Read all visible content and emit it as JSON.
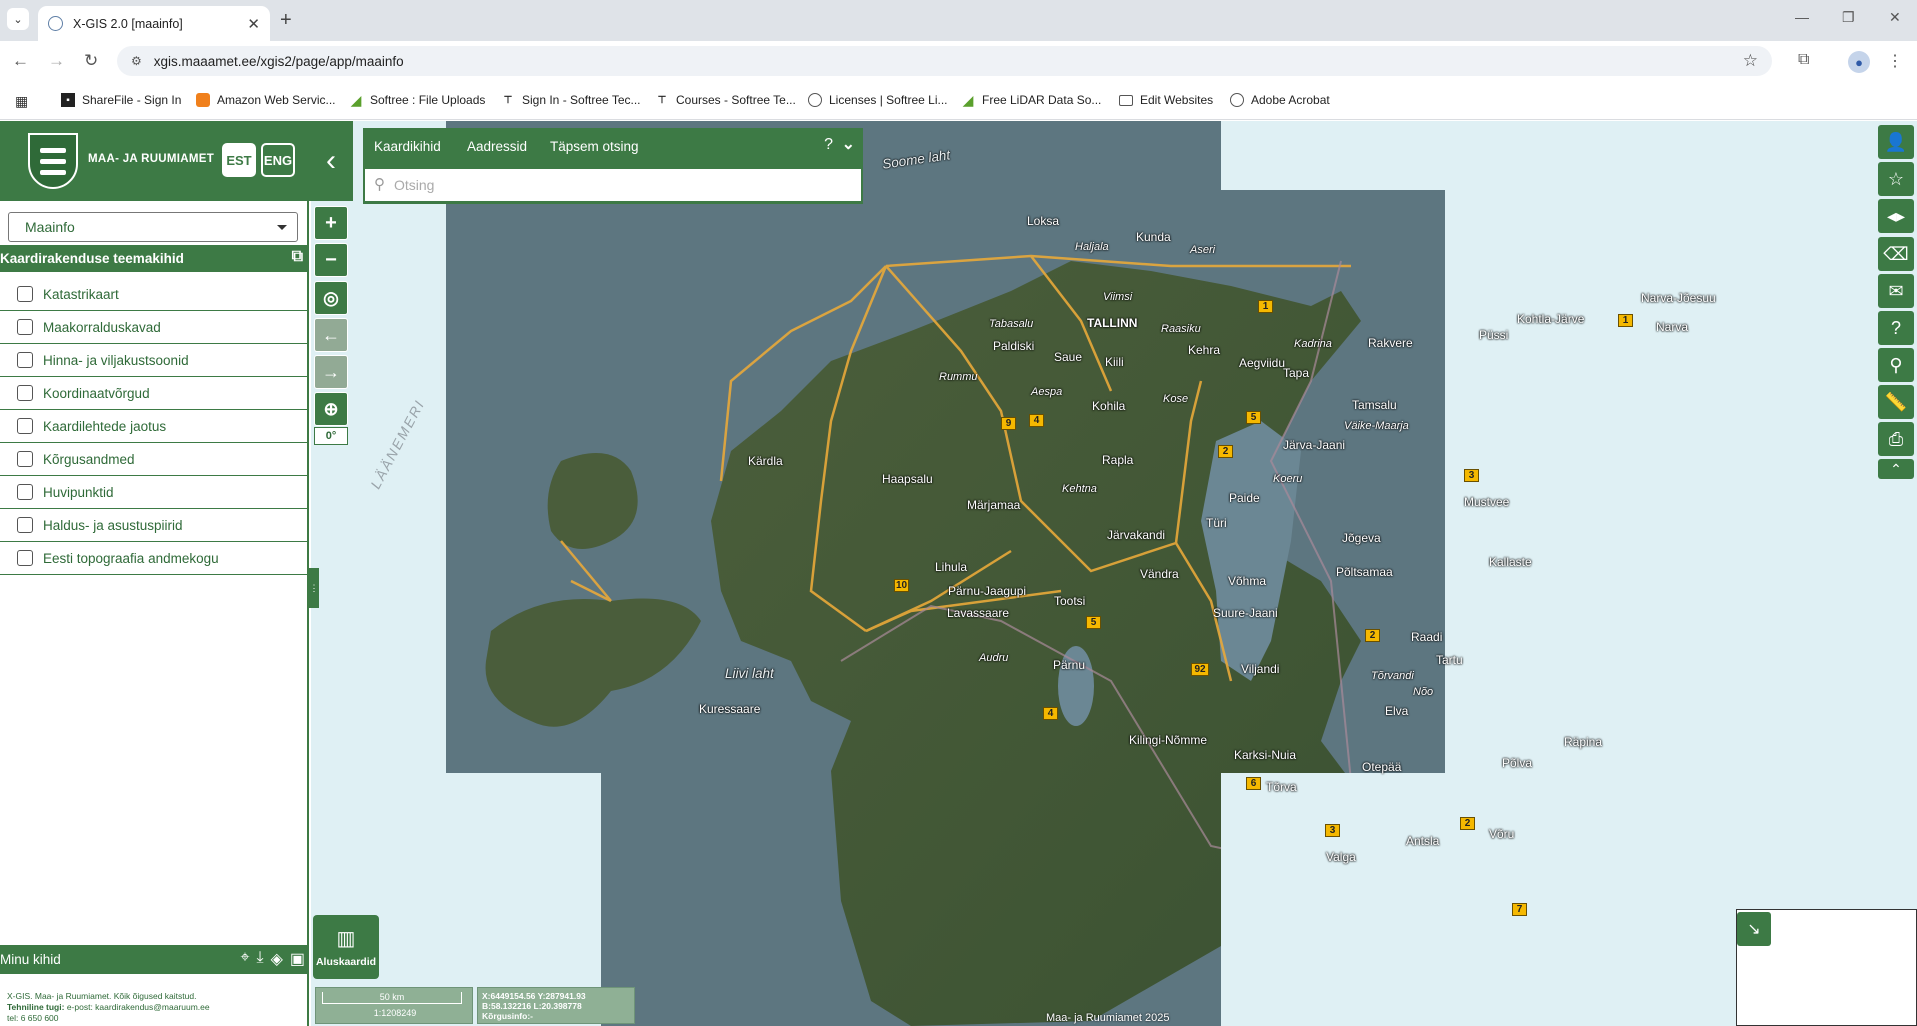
{
  "browser": {
    "tab_title": "X-GIS 2.0 [maainfo]",
    "url": "xgis.maaamet.ee/xgis2/page/app/maainfo",
    "bookmarks": [
      {
        "label": "ShareFile - Sign In",
        "icon": "sharefile-icon"
      },
      {
        "label": "Amazon Web Servic...",
        "icon": "aws-icon"
      },
      {
        "label": "Softree : File Uploads",
        "icon": "softree-icon"
      },
      {
        "label": "Sign In - Softree Tec...",
        "icon": "softree-tec-icon"
      },
      {
        "label": "Courses - Softree Te...",
        "icon": "softree-tec-icon"
      },
      {
        "label": "Licenses | Softree Li...",
        "icon": "globe-icon"
      },
      {
        "label": "Free LiDAR Data So...",
        "icon": "softree-icon"
      },
      {
        "label": "Edit Websites",
        "icon": "folder-icon"
      },
      {
        "label": "Adobe Acrobat",
        "icon": "globe-icon"
      }
    ]
  },
  "header": {
    "brand": "MAA- JA RUUMIAMET",
    "lang_est": "EST",
    "lang_eng": "ENG"
  },
  "sidebar": {
    "app_select": "Maainfo",
    "themes_title": "Kaardirakenduse teemakihid",
    "layers": [
      "Katastrikaart",
      "Maakorralduskavad",
      "Hinna- ja viljakustsoonid",
      "Koordinaatvõrgud",
      "Kaardilehtede jaotus",
      "Kõrgusandmed",
      "Huvipunktid",
      "Haldus- ja asustuspiirid",
      "Eesti topograafia andmekogu"
    ],
    "my_layers": "Minu kihid",
    "footer_line1": "X-GIS. Maa- ja Ruumiamet. Kõik õigused kaitstud.",
    "footer_support_bold": "Tehniline tugi:",
    "footer_support": " e-post: kaardirakendus@maaruum.ee",
    "footer_tel": "tel: 6 650 600"
  },
  "search": {
    "tabs": [
      "Kaardikihid",
      "Aadressid",
      "Täpsem otsing"
    ],
    "help": "?",
    "placeholder": "Otsing"
  },
  "map": {
    "rotation": "0°",
    "basemap_label": "Aluskaardid",
    "scale_label": "50 km",
    "scale_ratio": "1:1208249",
    "coord_line1": "X:6449154.56 Y:287941.93",
    "coord_line2": "B:58.132216 L:20.398778",
    "coord_line3": "Kõrgusinfo:-",
    "attribution": "Maa- ja Ruumiamet 2025",
    "sea_labels": [
      "Soome laht",
      "Liivi laht",
      "LÄÄNEMERI"
    ],
    "places": [
      "Loksa",
      "Kunda",
      "Haljala",
      "Aseri",
      "Narva-Jõesuu",
      "Narva",
      "Kohtla-Järve",
      "Püssi",
      "Rakvere",
      "Kadrina",
      "Viimsi",
      "TALLINN",
      "Tabasalu",
      "Paldiski",
      "Saue",
      "Kiili",
      "Raasiku",
      "Kehra",
      "Aegviidu",
      "Tapa",
      "Rummu",
      "Aespa",
      "Kohila",
      "Kose",
      "Tamsalu",
      "Väike-Maarja",
      "Järva-Jaani",
      "Koeru",
      "Kärdla",
      "Haapsalu",
      "Rapla",
      "Märjamaa",
      "Kehtna",
      "Paide",
      "Türi",
      "Järvakandi",
      "Jõgeva",
      "Mustvee",
      "Kallaste",
      "Lihula",
      "Pärnu-Jaagupi",
      "Lavassaare",
      "Tootsi",
      "Vändra",
      "Võhma",
      "Põltsamaa",
      "Suure-Jaani",
      "Raadi",
      "Tartu",
      "Audru",
      "Pärnu",
      "Viljandi",
      "Tõrvandi",
      "Nõo",
      "Elva",
      "Kuressaare",
      "Kilingi-Nõmme",
      "Karksi-Nuia",
      "Otepää",
      "Põlva",
      "Räpina",
      "Tõrva",
      "Antsla",
      "Võru",
      "Valga"
    ],
    "roads": [
      "1",
      "1",
      "9",
      "4",
      "5",
      "2",
      "3",
      "10",
      "5",
      "92",
      "2",
      "6",
      "4",
      "3",
      "2",
      "7"
    ]
  },
  "colors": {
    "brand_green": "#3d7a45"
  }
}
